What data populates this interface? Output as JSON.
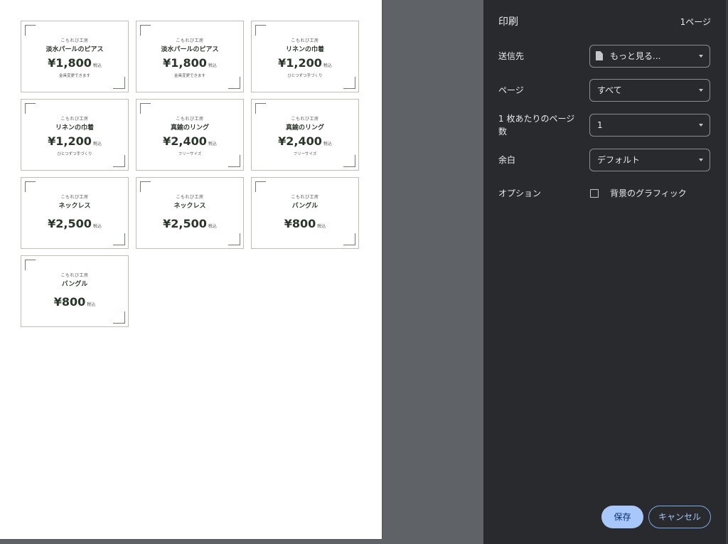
{
  "preview": {
    "cards": [
      {
        "shop": "こもれび工房",
        "name": "淡水パールのピアス",
        "price": "¥1,800",
        "tax": "税込",
        "note": "金具変更できます"
      },
      {
        "shop": "こもれび工房",
        "name": "淡水パールのピアス",
        "price": "¥1,800",
        "tax": "税込",
        "note": "金具変更できます"
      },
      {
        "shop": "こもれび工房",
        "name": "リネンの巾着",
        "price": "¥1,200",
        "tax": "税込",
        "note": "ひとつずつ手づくり"
      },
      {
        "shop": "こもれび工房",
        "name": "リネンの巾着",
        "price": "¥1,200",
        "tax": "税込",
        "note": "ひとつずつ手づくり"
      },
      {
        "shop": "こもれび工房",
        "name": "真鍮のリング",
        "price": "¥2,400",
        "tax": "税込",
        "note": "フリーサイズ"
      },
      {
        "shop": "こもれび工房",
        "name": "真鍮のリング",
        "price": "¥2,400",
        "tax": "税込",
        "note": "フリーサイズ"
      },
      {
        "shop": "こもれび工房",
        "name": "ネックレス",
        "price": "¥2,500",
        "tax": "税込",
        "note": ""
      },
      {
        "shop": "こもれび工房",
        "name": "ネックレス",
        "price": "¥2,500",
        "tax": "税込",
        "note": ""
      },
      {
        "shop": "こもれび工房",
        "name": "バングル",
        "price": "¥800",
        "tax": "税込",
        "note": ""
      },
      {
        "shop": "こもれび工房",
        "name": "バングル",
        "price": "¥800",
        "tax": "税込",
        "note": ""
      }
    ]
  },
  "panel": {
    "title": "印刷",
    "page_count": "1ページ",
    "destination": {
      "label": "送信先",
      "value": "もっと見る...",
      "icon": "document-icon"
    },
    "pages": {
      "label": "ページ",
      "value": "すべて"
    },
    "pages_per_sheet": {
      "label": "1 枚あたりのページ数",
      "value": "1"
    },
    "margins": {
      "label": "余白",
      "value": "デフォルト"
    },
    "options": {
      "label": "オプション",
      "checkbox_label": "背景のグラフィック",
      "checked": false
    },
    "save_label": "保存",
    "cancel_label": "キャンセル"
  },
  "colors": {
    "panel_bg": "#292a2d",
    "preview_bg": "#5f6368",
    "accent": "#a8c7fa"
  }
}
